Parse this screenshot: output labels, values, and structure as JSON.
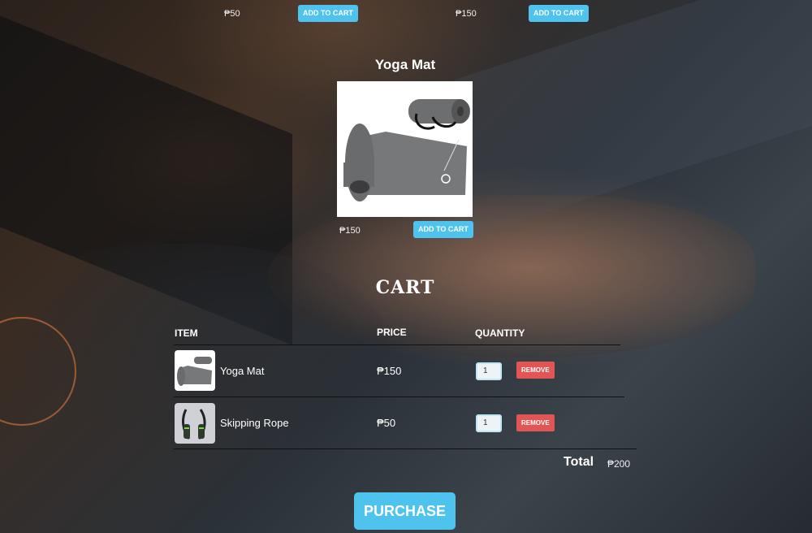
{
  "top_row": {
    "items": [
      {
        "price": "₱50",
        "add_label": "ADD TO CART"
      },
      {
        "price": "₱150",
        "add_label": "ADD TO CART"
      }
    ]
  },
  "featured": {
    "title": "Yoga Mat",
    "price": "₱150",
    "add_label": "ADD TO CART"
  },
  "cart": {
    "title": "CART",
    "headers": {
      "item": "ITEM",
      "price": "PRICE",
      "quantity": "QUANTITY"
    },
    "rows": [
      {
        "name": "Yoga Mat",
        "price": "₱150",
        "quantity": "1",
        "remove_label": "REMOVE"
      },
      {
        "name": "Skipping Rope",
        "price": "₱50",
        "quantity": "1",
        "remove_label": "REMOVE"
      }
    ],
    "total_label": "Total",
    "total_value": "₱200",
    "purchase_label": "PURCHASE"
  },
  "colors": {
    "accent": "#4ec3ee",
    "danger": "#e25555"
  }
}
